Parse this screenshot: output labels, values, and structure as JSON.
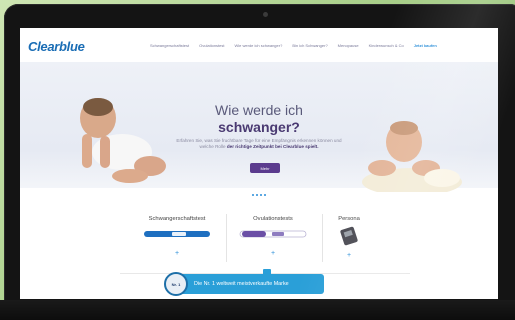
{
  "header": {
    "logo_text": "Clearblue",
    "nav": [
      "Schwangerschaftstest",
      "Ovulationstest",
      "Wie werde ich schwanger?",
      "Bin ich Schwanger?",
      "Menopause",
      "Kinderwunsch & Co",
      "Jetzt kaufen"
    ]
  },
  "hero": {
    "title_line1": "Wie werde ich",
    "title_line2": "schwanger?",
    "subtitle": "Erfahren Sie, was Sie fruchtbare Tage für eine Empfängnis erkennen können und welche Rolle",
    "subtitle_bold": "der richtige Zeitpunkt bei Clearblue spielt.",
    "button_label": "Mehr"
  },
  "products": [
    {
      "title": "Schwangerschaftstest",
      "plus": "+"
    },
    {
      "title": "Ovulationstests",
      "plus": "+"
    },
    {
      "title": "Persona",
      "plus": "+"
    }
  ],
  "badge": {
    "seal_text": "Nr. 1",
    "label": "Die Nr. 1 weltweit meistverkaufte Marke"
  },
  "colors": {
    "brand": "#1a6db5",
    "accent": "#2a9fd8",
    "hero_button": "#5b3b8e",
    "title": "#4a3a72"
  }
}
